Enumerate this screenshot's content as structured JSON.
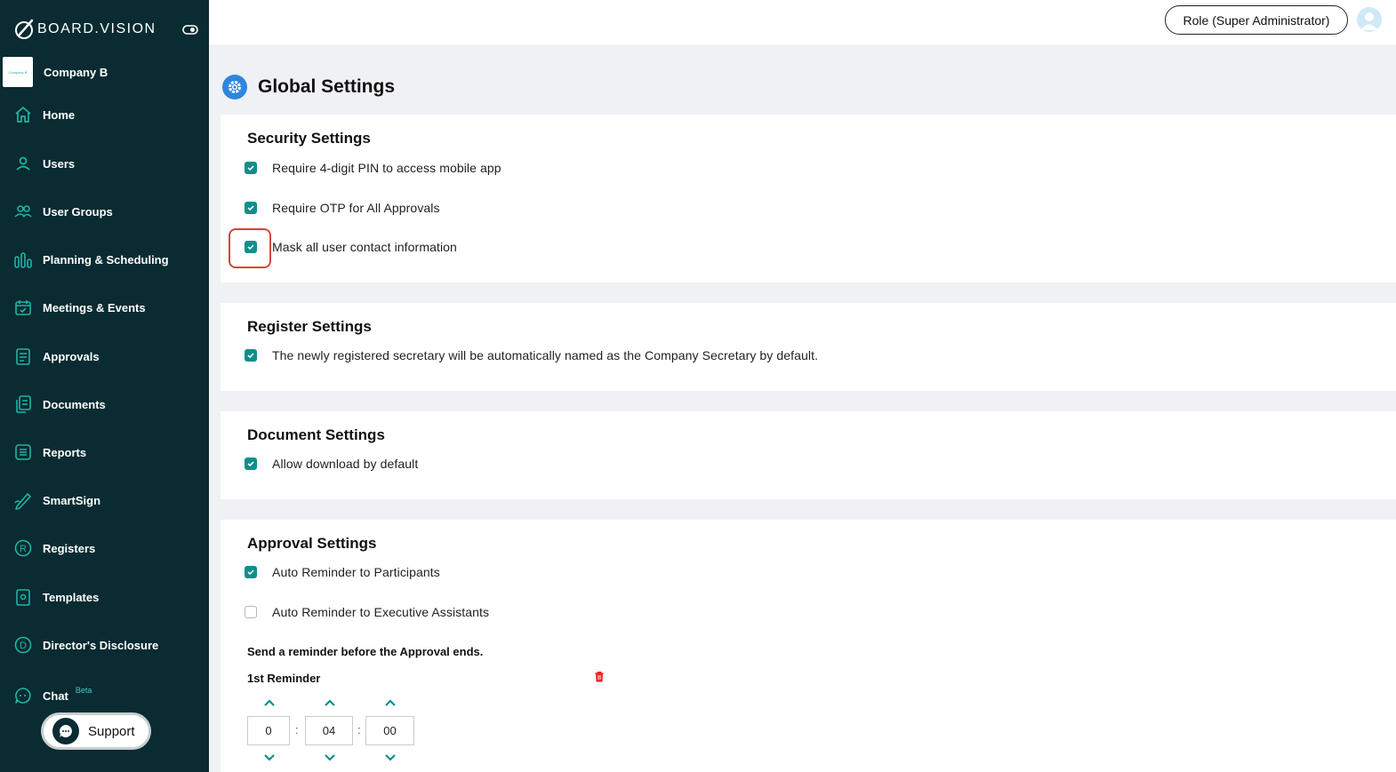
{
  "app": {
    "logo_text": "BOARD.VISION"
  },
  "company": {
    "name": "Company B",
    "logo_text": "Company B"
  },
  "sidebar": {
    "items": [
      {
        "label": "Home",
        "icon": "home-icon"
      },
      {
        "label": "Users",
        "icon": "user-icon"
      },
      {
        "label": "User Groups",
        "icon": "users-icon"
      },
      {
        "label": "Planning & Scheduling",
        "icon": "bar-chart-icon"
      },
      {
        "label": "Meetings & Events",
        "icon": "calendar-icon"
      },
      {
        "label": "Approvals",
        "icon": "document-check-icon"
      },
      {
        "label": "Documents",
        "icon": "documents-icon"
      },
      {
        "label": "Reports",
        "icon": "list-icon"
      },
      {
        "label": "SmartSign",
        "icon": "pen-icon"
      },
      {
        "label": "Registers",
        "icon": "registered-icon"
      },
      {
        "label": "Templates",
        "icon": "template-icon"
      },
      {
        "label": "Director's Disclosure",
        "icon": "disclosure-icon"
      },
      {
        "label": "Chat",
        "icon": "chat-icon",
        "badge": "Beta"
      }
    ],
    "support_label": "Support"
  },
  "header": {
    "role_label": "Role (Super Administrator)"
  },
  "page": {
    "title": "Global Settings"
  },
  "security": {
    "title": "Security Settings",
    "options": [
      {
        "label": "Require 4-digit PIN to access mobile app",
        "checked": true
      },
      {
        "label": "Require OTP for All Approvals",
        "checked": true
      },
      {
        "label": "Mask all user contact information",
        "checked": true
      }
    ]
  },
  "register": {
    "title": "Register Settings",
    "options": [
      {
        "label": "The newly registered secretary will be automatically named as the Company Secretary by default.",
        "checked": true
      }
    ]
  },
  "document": {
    "title": "Document Settings",
    "options": [
      {
        "label": "Allow download by default",
        "checked": true
      }
    ]
  },
  "approval": {
    "title": "Approval Settings",
    "options": [
      {
        "label": "Auto Reminder to Participants",
        "checked": true
      },
      {
        "label": "Auto Reminder to Executive Assistants",
        "checked": false
      }
    ],
    "reminder_intro": "Send a reminder before the Approval ends.",
    "reminder_title": "1st Reminder",
    "days": "0",
    "hours": "04",
    "minutes": "00"
  },
  "colors": {
    "sidebar": "#092b31",
    "accent": "#0e8f8c",
    "highlight": "#d2473a",
    "gear": "#2e86de"
  }
}
